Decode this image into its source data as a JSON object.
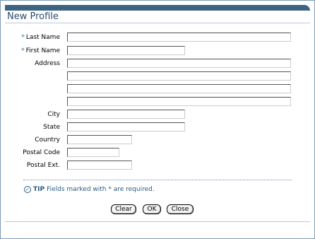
{
  "title": "New Profile",
  "fields": {
    "last_name": {
      "label": "Last Name",
      "required_mark": "*",
      "value": ""
    },
    "first_name": {
      "label": "First Name",
      "required_mark": "*",
      "value": ""
    },
    "address": {
      "label": "Address",
      "lines": [
        "",
        "",
        "",
        ""
      ]
    },
    "city": {
      "label": "City",
      "value": ""
    },
    "state": {
      "label": "State",
      "value": ""
    },
    "country": {
      "label": "Country",
      "value": ""
    },
    "postal_code": {
      "label": "Postal Code",
      "value": ""
    },
    "postal_ext": {
      "label": "Postal Ext.",
      "value": ""
    }
  },
  "tip": {
    "icon": "check-circle-icon",
    "label": "TIP",
    "text": "Fields marked with * are required."
  },
  "buttons": {
    "clear": "Clear",
    "ok": "OK",
    "close": "Close"
  },
  "colors": {
    "accent": "#3c6382",
    "title": "#2b4a6b",
    "tip": "#2b5a80"
  }
}
